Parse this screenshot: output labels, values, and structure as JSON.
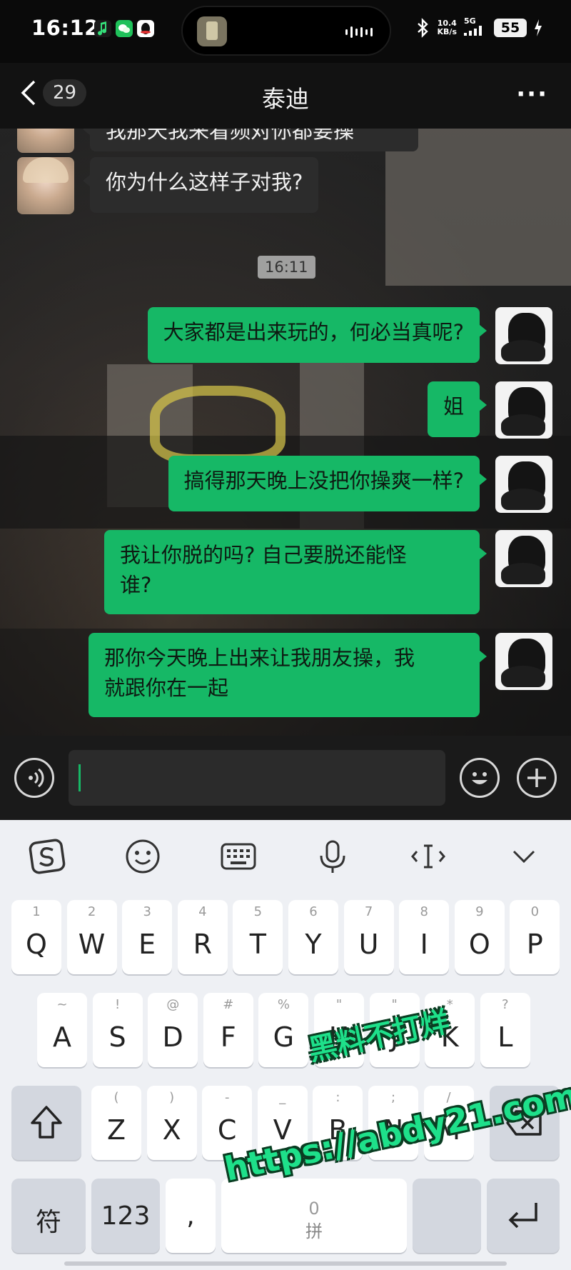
{
  "status_bar": {
    "time": "16:12",
    "net_speed_value": "10.4",
    "net_speed_unit": "KB/s",
    "signal_label": "5G",
    "battery": "55"
  },
  "header": {
    "unread_count": "29",
    "title": "泰迪",
    "more": "···"
  },
  "messages": {
    "partial_in": "我那天我来看频对你都要操",
    "in_1": "你为什么这样子对我?",
    "timestamp": "16:11",
    "out_1": "大家都是出来玩的，何必当真呢?",
    "out_2": "姐",
    "out_3": "搞得那天晚上没把你操爽一样?",
    "out_4_line1": "我让你脱的吗? 自己要脱还能怪",
    "out_4_line2": "谁?",
    "out_5_line1": "那你今天晚上出来让我朋友操，我",
    "out_5_line2": "就跟你在一起"
  },
  "keyboard": {
    "row1": [
      {
        "sub": "1",
        "main": "Q"
      },
      {
        "sub": "2",
        "main": "W"
      },
      {
        "sub": "3",
        "main": "E"
      },
      {
        "sub": "4",
        "main": "R"
      },
      {
        "sub": "5",
        "main": "T"
      },
      {
        "sub": "6",
        "main": "Y"
      },
      {
        "sub": "7",
        "main": "U"
      },
      {
        "sub": "8",
        "main": "I"
      },
      {
        "sub": "9",
        "main": "O"
      },
      {
        "sub": "0",
        "main": "P"
      }
    ],
    "row2": [
      {
        "sub": "~",
        "main": "A"
      },
      {
        "sub": "!",
        "main": "S"
      },
      {
        "sub": "@",
        "main": "D"
      },
      {
        "sub": "#",
        "main": "F"
      },
      {
        "sub": "%",
        "main": "G"
      },
      {
        "sub": "\"",
        "main": "H"
      },
      {
        "sub": "\"",
        "main": "J"
      },
      {
        "sub": "*",
        "main": "K"
      },
      {
        "sub": "?",
        "main": "L"
      }
    ],
    "row3": [
      {
        "sub": "(",
        "main": "Z"
      },
      {
        "sub": ")",
        "main": "X"
      },
      {
        "sub": "-",
        "main": "C"
      },
      {
        "sub": "_",
        "main": "V"
      },
      {
        "sub": ":",
        "main": "B"
      },
      {
        "sub": ";",
        "main": "N"
      },
      {
        "sub": "/",
        "main": "M"
      }
    ],
    "fu": "符",
    "num": "123",
    "comma": ",",
    "space_hint": "0",
    "space_label": "拼"
  },
  "watermark": {
    "line1": "黑料不打烊",
    "line2": "https://abdy21.com"
  },
  "colors": {
    "accent": "#16b866",
    "incoming_bubble": "#2c2c2c",
    "keyboard_bg": "#eef0f4"
  }
}
